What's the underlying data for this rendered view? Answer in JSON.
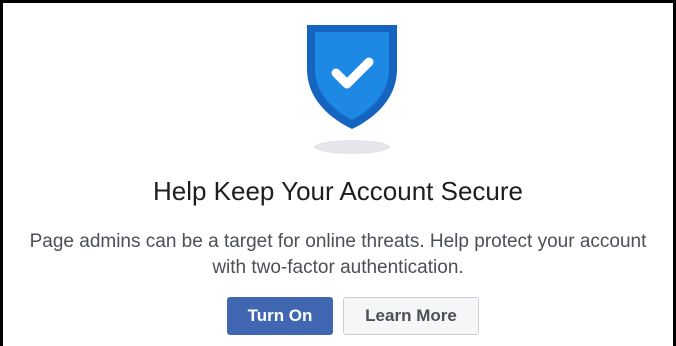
{
  "dialog": {
    "title": "Help Keep Your Account Secure",
    "description": "Page admins can be a target for online threats. Help protect your account with two-factor authentication.",
    "icon": "shield-check-icon",
    "primary_button": "Turn On",
    "secondary_button": "Learn More"
  },
  "colors": {
    "primary": "#4267b2",
    "shield_dark": "#1565c0",
    "shield_light": "#1e88e5",
    "title_text": "#1c1e21",
    "body_text": "#4b4f56",
    "secondary_button_bg": "#f5f6f7"
  }
}
